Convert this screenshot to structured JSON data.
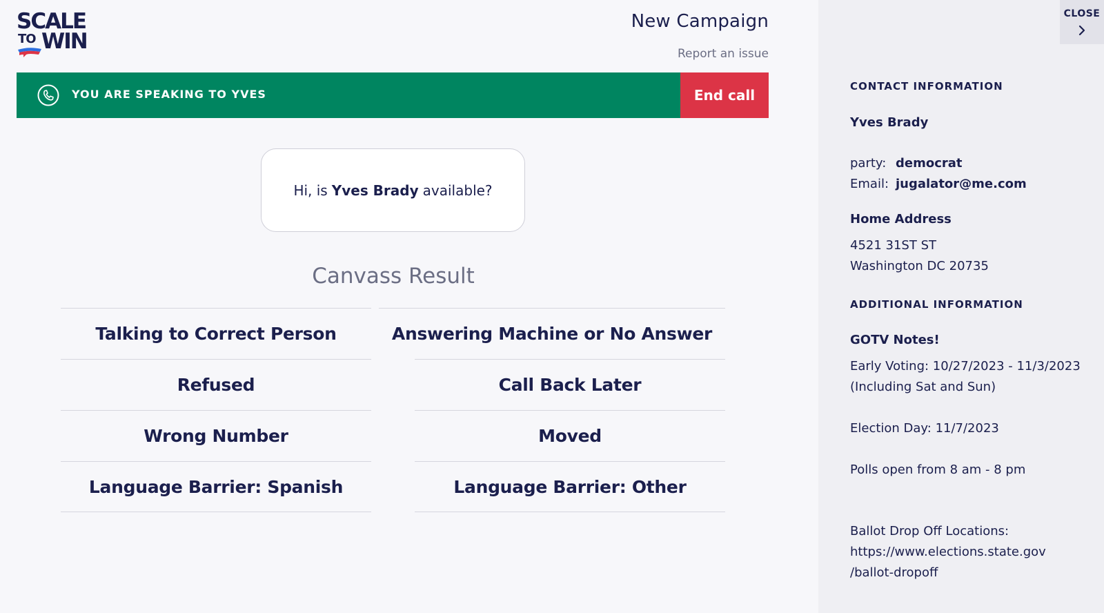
{
  "logo": {
    "line1": "SCALE",
    "line2a": "TO",
    "line2b": "WIN"
  },
  "header": {
    "title": "New Campaign",
    "report_link": "Report an issue"
  },
  "call_bar": {
    "prefix": "YOU ARE SPEAKING TO",
    "name": "YVES",
    "end_call_label": "End call",
    "colors": {
      "bar": "#008560",
      "end_call": "#dc3446"
    }
  },
  "script": {
    "before": "Hi, is",
    "name": "Yves Brady",
    "after": "available?"
  },
  "canvass": {
    "title": "Canvass Result",
    "results": [
      "Talking to Correct Person",
      "Answering Machine or No Answer",
      "Refused",
      "Call Back Later",
      "Wrong Number",
      "Moved",
      "Language Barrier: Spanish",
      "Language Barrier: Other"
    ]
  },
  "sidebar": {
    "close_label": "CLOSE",
    "contact_heading": "CONTACT INFORMATION",
    "contact_name": "Yves Brady",
    "party_label": "party:",
    "party_value": "democrat",
    "email_label": "Email:",
    "email_value": "jugalator@me.com",
    "home_address_heading": "Home Address",
    "address_line1": "4521 31ST ST",
    "address_line2": "Washington DC 20735",
    "additional_heading": "ADDITIONAL INFORMATION",
    "notes_heading": "GOTV Notes!",
    "early_voting_line1": "Early Voting: 10/27/2023 - 11/3/2023",
    "early_voting_line2": "(Including Sat and Sun)",
    "election_day": "Election Day: 11/7/2023",
    "polls": "Polls open from 8 am - 8 pm",
    "ballot_line1": "Ballot Drop Off Locations:",
    "ballot_line2": "https://www.elections.state.gov",
    "ballot_line3": "/ballot-dropoff"
  }
}
